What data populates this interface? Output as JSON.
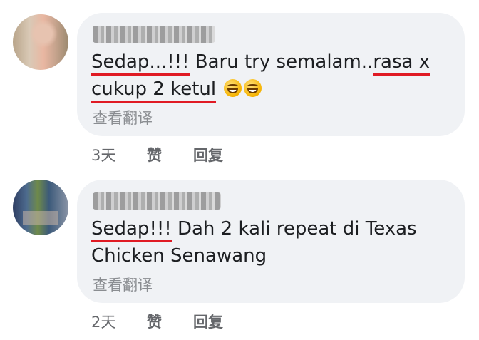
{
  "comments": [
    {
      "text_parts": [
        "Sedap...!!!",
        " Baru try semalam..",
        "rasa x",
        " ",
        "cukup 2 ketul",
        " "
      ],
      "translate_label": "查看翻译",
      "time": "3天",
      "like_label": "赞",
      "reply_label": "回复"
    },
    {
      "text_parts": [
        "Sedap!!!",
        " Dah 2 kali repeat di Texas Chicken Senawang"
      ],
      "translate_label": "查看翻译",
      "time": "2天",
      "like_label": "赞",
      "reply_label": "回复"
    }
  ],
  "emoji": [
    "grinning-squinting-face-icon",
    "grinning-squinting-face-icon"
  ],
  "colors": {
    "bubble": "#f0f2f5",
    "underline": "#e01b24",
    "meta": "#65676b"
  }
}
